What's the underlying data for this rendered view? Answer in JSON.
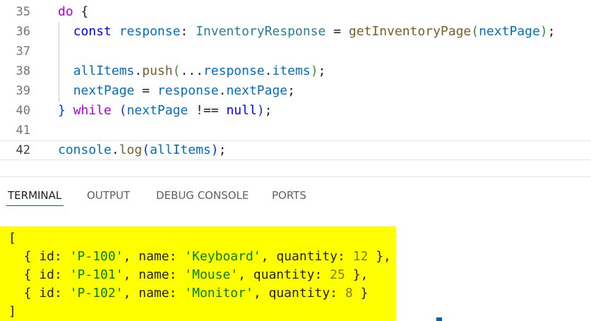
{
  "editor": {
    "lines": [
      {
        "num": "35",
        "tokens": [
          {
            "t": "do",
            "c": "kw"
          },
          {
            "t": " {",
            "c": "pl"
          }
        ]
      },
      {
        "num": "36",
        "tokens": [
          {
            "t": "  ",
            "c": "pl"
          },
          {
            "t": "const",
            "c": "kw2"
          },
          {
            "t": " ",
            "c": "pl"
          },
          {
            "t": "response",
            "c": "var"
          },
          {
            "t": ": ",
            "c": "pl"
          },
          {
            "t": "InventoryResponse",
            "c": "typ"
          },
          {
            "t": " = ",
            "c": "pl"
          },
          {
            "t": "getInventoryPage",
            "c": "fn"
          },
          {
            "t": "(",
            "c": "br2"
          },
          {
            "t": "nextPage",
            "c": "var"
          },
          {
            "t": ")",
            "c": "br2"
          },
          {
            "t": ";",
            "c": "pl"
          }
        ]
      },
      {
        "num": "37",
        "tokens": []
      },
      {
        "num": "38",
        "tokens": [
          {
            "t": "  ",
            "c": "pl"
          },
          {
            "t": "allItems",
            "c": "var"
          },
          {
            "t": ".",
            "c": "pl"
          },
          {
            "t": "push",
            "c": "fn"
          },
          {
            "t": "(",
            "c": "br2"
          },
          {
            "t": "...",
            "c": "pl"
          },
          {
            "t": "response",
            "c": "var"
          },
          {
            "t": ".",
            "c": "pl"
          },
          {
            "t": "items",
            "c": "var"
          },
          {
            "t": ")",
            "c": "br2"
          },
          {
            "t": ";",
            "c": "pl"
          }
        ]
      },
      {
        "num": "39",
        "tokens": [
          {
            "t": "  ",
            "c": "pl"
          },
          {
            "t": "nextPage",
            "c": "var"
          },
          {
            "t": " = ",
            "c": "pl"
          },
          {
            "t": "response",
            "c": "var"
          },
          {
            "t": ".",
            "c": "pl"
          },
          {
            "t": "nextPage",
            "c": "var"
          },
          {
            "t": ";",
            "c": "pl"
          }
        ]
      },
      {
        "num": "40",
        "tokens": [
          {
            "t": "}",
            "c": "br1"
          },
          {
            "t": " ",
            "c": "pl"
          },
          {
            "t": "while",
            "c": "kw"
          },
          {
            "t": " ",
            "c": "pl"
          },
          {
            "t": "(",
            "c": "br1"
          },
          {
            "t": "nextPage",
            "c": "var"
          },
          {
            "t": " !== ",
            "c": "pl"
          },
          {
            "t": "null",
            "c": "kw2"
          },
          {
            "t": ")",
            "c": "br1"
          },
          {
            "t": ";",
            "c": "pl"
          }
        ]
      },
      {
        "num": "41",
        "tokens": []
      },
      {
        "num": "42",
        "tokens": [
          {
            "t": "console",
            "c": "var"
          },
          {
            "t": ".",
            "c": "pl"
          },
          {
            "t": "log",
            "c": "fn"
          },
          {
            "t": "(",
            "c": "br1"
          },
          {
            "t": "allItems",
            "c": "var"
          },
          {
            "t": ")",
            "c": "br1"
          },
          {
            "t": ";",
            "c": "pl"
          }
        ]
      }
    ],
    "current_line": "42"
  },
  "panel": {
    "tabs": [
      {
        "label": "TERMINAL",
        "active": true
      },
      {
        "label": "OUTPUT",
        "active": false
      },
      {
        "label": "DEBUG CONSOLE",
        "active": false
      },
      {
        "label": "PORTS",
        "active": false
      }
    ],
    "terminal_highlight_color": "#ffff00",
    "terminal_lines": [
      [
        {
          "t": "[",
          "c": "pl"
        }
      ],
      [
        {
          "t": "  { id: ",
          "c": "pl"
        },
        {
          "t": "'P-100'",
          "c": "str"
        },
        {
          "t": ", name: ",
          "c": "pl"
        },
        {
          "t": "'Keyboard'",
          "c": "str"
        },
        {
          "t": ", quantity: ",
          "c": "pl"
        },
        {
          "t": "12",
          "c": "num"
        },
        {
          "t": " },",
          "c": "pl"
        }
      ],
      [
        {
          "t": "  { id: ",
          "c": "pl"
        },
        {
          "t": "'P-101'",
          "c": "str"
        },
        {
          "t": ", name: ",
          "c": "pl"
        },
        {
          "t": "'Mouse'",
          "c": "str"
        },
        {
          "t": ", quantity: ",
          "c": "pl"
        },
        {
          "t": "25",
          "c": "num"
        },
        {
          "t": " },",
          "c": "pl"
        }
      ],
      [
        {
          "t": "  { id: ",
          "c": "pl"
        },
        {
          "t": "'P-102'",
          "c": "str"
        },
        {
          "t": ", name: ",
          "c": "pl"
        },
        {
          "t": "'Monitor'",
          "c": "str"
        },
        {
          "t": ", quantity: ",
          "c": "pl"
        },
        {
          "t": "8",
          "c": "num"
        },
        {
          "t": " }",
          "c": "pl"
        }
      ],
      [
        {
          "t": "]",
          "c": "pl"
        }
      ]
    ]
  },
  "colors": {
    "accent": "#005fb8",
    "highlight": "#ffff00"
  }
}
